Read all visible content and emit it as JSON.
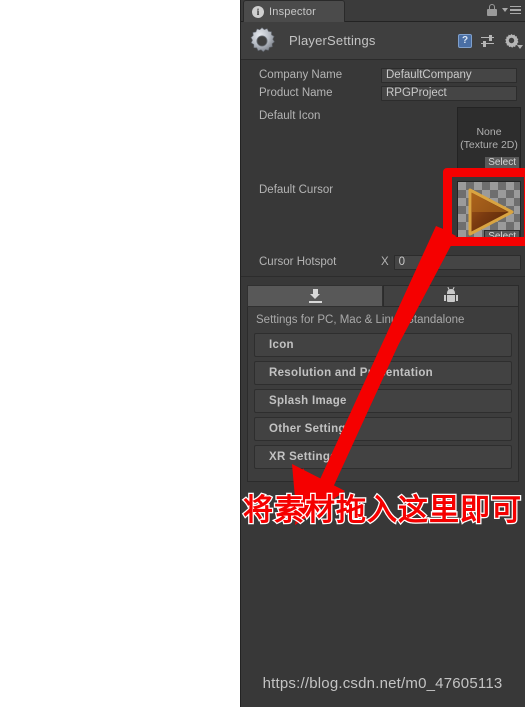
{
  "window": {
    "tab_label": "Inspector",
    "info_icon": "info-icon",
    "lock_icon": "lock-icon",
    "menu_icon": "hamburger-menu-icon"
  },
  "object_header": {
    "title": "PlayerSettings",
    "gear_icon": "gear-icon",
    "help_icon": "help-book-icon",
    "preset_icon": "preset-icon",
    "settings_gear_icon": "gear-dropdown-icon"
  },
  "properties": {
    "company_name": {
      "label": "Company Name",
      "value": "DefaultCompany"
    },
    "product_name": {
      "label": "Product Name",
      "value": "RPGProject"
    },
    "default_icon": {
      "label": "Default Icon",
      "value": "None\n(Texture 2D)",
      "select_label": "Select"
    },
    "default_cursor": {
      "label": "Default Cursor",
      "value": "",
      "select_label": "Select"
    },
    "cursor_hotspot": {
      "label": "Cursor Hotspot",
      "axis": "X",
      "value": "0"
    }
  },
  "platform_tabs": [
    {
      "name": "standalone",
      "icon": "download-icon",
      "active": true
    },
    {
      "name": "android",
      "icon": "android-robot-icon",
      "active": false
    }
  ],
  "platform_panel": {
    "description": "Settings for PC, Mac & Linux Standalone",
    "sections": [
      {
        "label": "Icon"
      },
      {
        "label": "Resolution and Presentation"
      },
      {
        "label": "Splash Image"
      },
      {
        "label": "Other Settings"
      },
      {
        "label": "XR Settings"
      }
    ]
  },
  "annotations": {
    "note_text": "将素材拖入这里即可",
    "highlight_color": "#f50000",
    "arrow_color": "#f50000",
    "watermark": "https://blog.csdn.net/m0_47605113"
  }
}
